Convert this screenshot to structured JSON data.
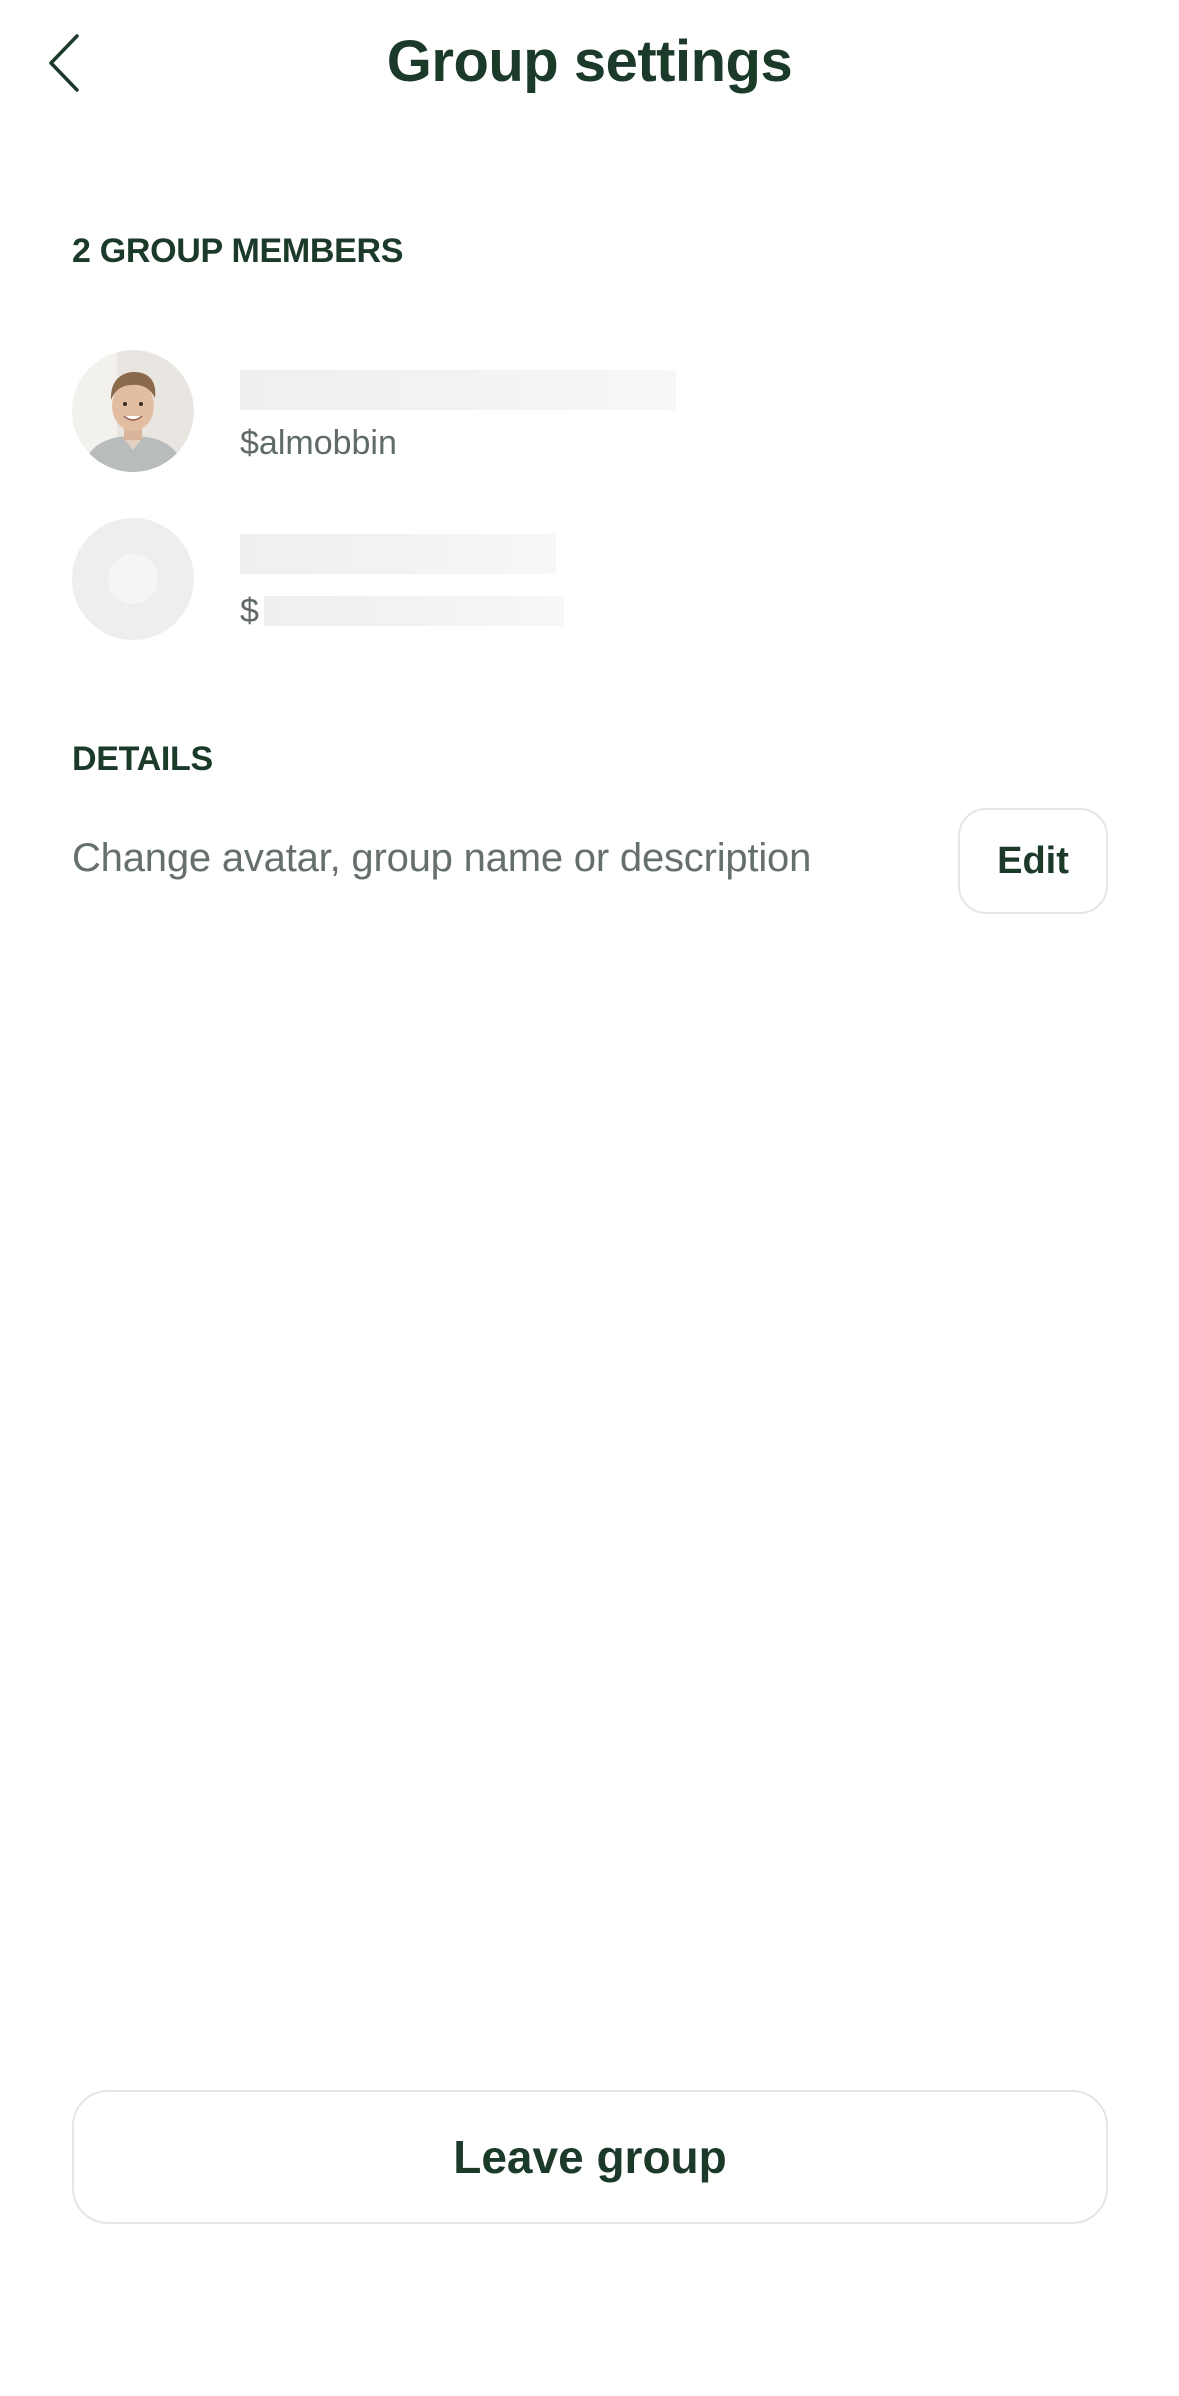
{
  "header": {
    "title": "Group settings",
    "back_icon": "chevron-left-icon"
  },
  "members_section": {
    "label": "2 GROUP MEMBERS",
    "members": [
      {
        "handle": "$almobbin",
        "avatar": "photo"
      },
      {
        "handle": "$",
        "avatar": "placeholder"
      }
    ]
  },
  "details_section": {
    "label": "DETAILS",
    "description": "Change avatar, group name or description",
    "edit_label": "Edit"
  },
  "footer": {
    "leave_label": "Leave group"
  },
  "colors": {
    "primary_text": "#1b3a2a",
    "secondary_text": "#66706a",
    "border": "#e3e6e4",
    "skeleton": "#efefef"
  }
}
